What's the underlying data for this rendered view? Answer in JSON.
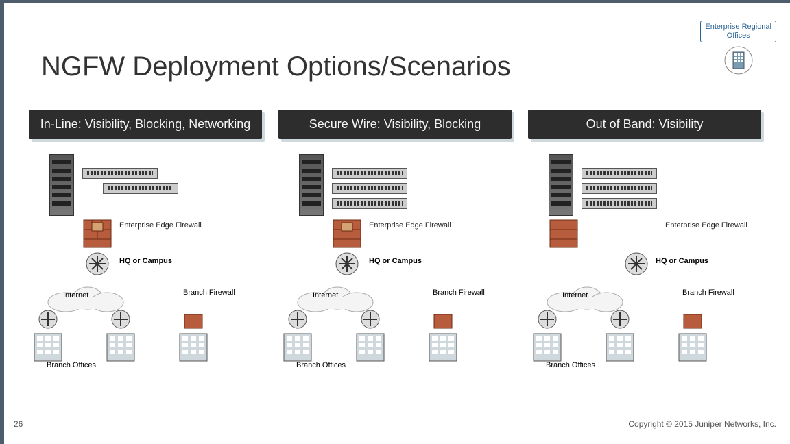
{
  "badge": {
    "line1": "Enterprise Regional",
    "line2": "Offices"
  },
  "title": "NGFW Deployment Options/Scenarios",
  "columns": [
    {
      "header": "In-Line: Visibility, Blocking, Networking"
    },
    {
      "header": "Secure Wire: Visibility, Blocking"
    },
    {
      "header": "Out of Band: Visibility"
    }
  ],
  "labels": {
    "enterprise_edge_firewall": "Enterprise Edge Firewall",
    "hq_or_campus": "HQ or Campus",
    "internet": "Internet",
    "branch_firewall": "Branch Firewall",
    "branch_offices": "Branch Offices"
  },
  "page_number": "26",
  "copyright": "Copyright © 2015 Juniper Networks, Inc.",
  "icons": {
    "office_building": "office-building-icon",
    "firewall": "firewall-icon",
    "router": "router-icon",
    "cloud": "cloud-icon",
    "server_rack": "server-rack-icon",
    "switch": "switch-icon"
  }
}
